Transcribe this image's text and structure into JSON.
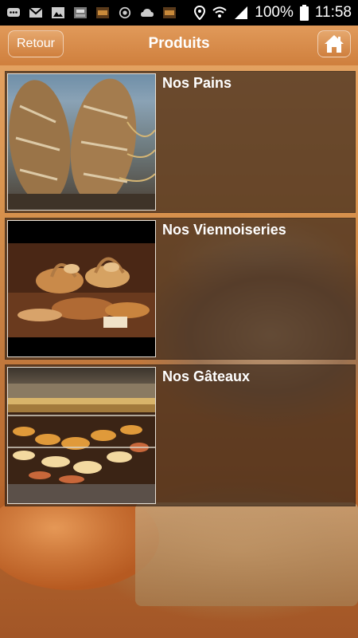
{
  "status_bar": {
    "battery": "100%",
    "time": "11:58"
  },
  "header": {
    "title": "Produits",
    "back_label": "Retour"
  },
  "items": [
    {
      "title": "Nos Pains"
    },
    {
      "title": "Nos Viennoiseries"
    },
    {
      "title": "Nos Gâteaux"
    }
  ]
}
